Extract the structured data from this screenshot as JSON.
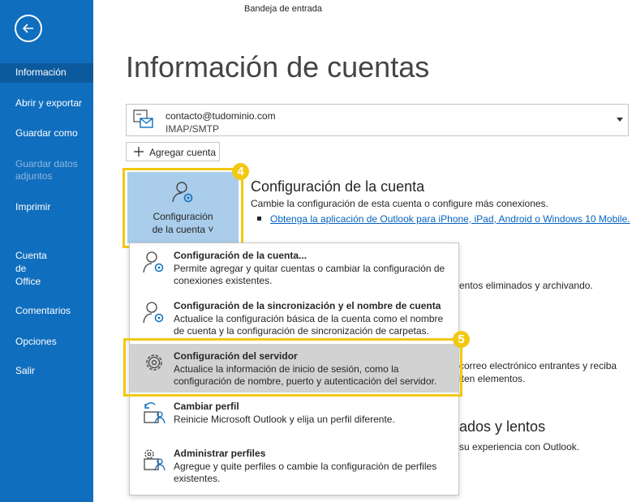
{
  "window": {
    "title": "Bandeja de entrada"
  },
  "sidebar": {
    "back_icon": "back-arrow-icon",
    "items": [
      {
        "label": "Información"
      },
      {
        "label": "Abrir y exportar"
      },
      {
        "label": "Guardar como"
      },
      {
        "label": "Guardar datos adjuntos"
      },
      {
        "label": "Imprimir"
      },
      {
        "label": "Cuenta de Office"
      },
      {
        "label": "Comentarios"
      },
      {
        "label": "Opciones"
      },
      {
        "label": "Salir"
      }
    ]
  },
  "main": {
    "title": "Información de cuentas",
    "account": {
      "email": "contacto@tudominio.com",
      "type": "IMAP/SMTP"
    },
    "add_account_label": "Agregar cuenta",
    "account_settings_button": {
      "line1": "Configuración",
      "line2": "de la cuenta ˅"
    },
    "section": {
      "title": "Configuración de la cuenta",
      "description": "Cambie la configuración de esta cuenta o configure más conexiones.",
      "link": "Obtenga la aplicación de Outlook para iPhone, iPad, Android o Windows 10 Mobile."
    },
    "background_fragments": {
      "f1": "entos eliminados y archivando.",
      "f2": "correo electrónico entrantes y reciba",
      "f3": "iten elementos.",
      "f4": "ados y lentos",
      "f5": "su experiencia con Outlook."
    },
    "steps": {
      "s1": "4",
      "s2": "5"
    }
  },
  "menu": {
    "items": [
      {
        "title": "Configuración de la cuenta...",
        "desc": "Permite agregar y quitar cuentas o cambiar la configuración de conexiones existentes."
      },
      {
        "title": "Configuración de la sincronización y el nombre de cuenta",
        "desc": "Actualice la configuración básica de la cuenta como el nombre de cuenta y la configuración de sincronización de carpetas."
      },
      {
        "title": "Configuración del servidor",
        "desc": "Actualice la información de inicio de sesión, como la configuración de nombre, puerto y autenticación del servidor."
      },
      {
        "title": "Cambiar perfil",
        "desc": "Reinicie Microsoft Outlook y elija un perfil diferente."
      },
      {
        "title": "Administrar perfiles",
        "desc": "Agregue y quite perfiles o cambie la configuración de perfiles existentes."
      }
    ]
  },
  "colors": {
    "sidebar": "#106ebe",
    "sidebar_selected": "#0c5a9e",
    "accent_button": "#a9cdea",
    "highlight": "#f2c811",
    "link": "#0563c1"
  }
}
